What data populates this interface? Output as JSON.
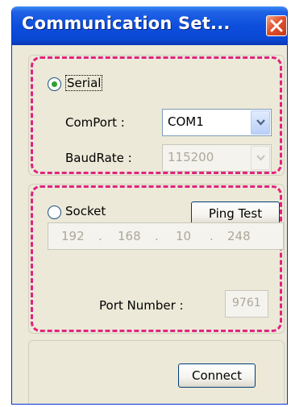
{
  "window": {
    "title": "Communication Set..."
  },
  "serial": {
    "radio_label": "Serial",
    "selected": true,
    "comport": {
      "label": "ComPort :",
      "value": "COM1"
    },
    "baudrate": {
      "label": "BaudRate :",
      "value": "115200"
    }
  },
  "socket": {
    "radio_label": "Socket",
    "selected": false,
    "ping_button": "Ping Test",
    "ip": {
      "octet1": "192",
      "octet2": "168",
      "octet3": "10",
      "octet4": "248",
      "dot": "."
    },
    "port": {
      "label": "Port Number :",
      "value": "9761"
    }
  },
  "actions": {
    "connect_button": "Connect"
  },
  "colors": {
    "titlebar": "#0a47d2",
    "annotation_dash": "#e0247f",
    "window_bg": "#ece9d8"
  }
}
